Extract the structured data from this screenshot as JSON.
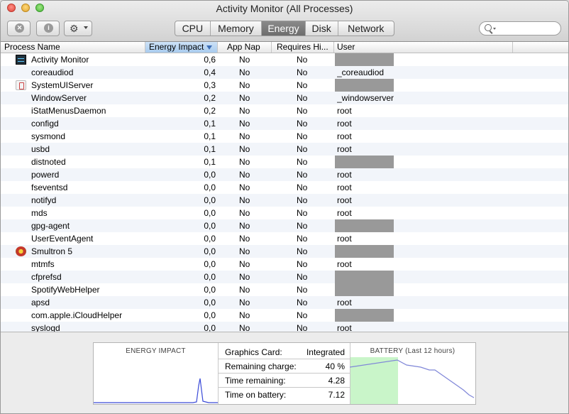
{
  "window": {
    "title": "Activity Monitor (All Processes)"
  },
  "toolbar": {
    "stop_symbol": "✕",
    "info_symbol": "i",
    "gear_symbol": "⚙",
    "tabs": [
      {
        "label": "CPU",
        "active": false
      },
      {
        "label": "Memory",
        "active": false
      },
      {
        "label": "Energy",
        "active": true
      },
      {
        "label": "Disk",
        "active": false
      },
      {
        "label": "Network",
        "active": false
      }
    ],
    "search": {
      "value": "",
      "placeholder": ""
    }
  },
  "table": {
    "columns": {
      "name": "Process Name",
      "energy": "Energy Impact",
      "app_nap": "App Nap",
      "requires_hi": "Requires Hi...",
      "user": "User"
    },
    "rows": [
      {
        "name": "Activity Monitor",
        "energy": "0,6",
        "app_nap": "No",
        "requires_hi": "No",
        "user": "",
        "icon": "activity-monitor-icon"
      },
      {
        "name": "coreaudiod",
        "energy": "0,4",
        "app_nap": "No",
        "requires_hi": "No",
        "user": "_coreaudiod"
      },
      {
        "name": "SystemUIServer",
        "energy": "0,3",
        "app_nap": "No",
        "requires_hi": "No",
        "user": "",
        "icon": "system-ui-server-icon"
      },
      {
        "name": "WindowServer",
        "energy": "0,2",
        "app_nap": "No",
        "requires_hi": "No",
        "user": "_windowserver"
      },
      {
        "name": "iStatMenusDaemon",
        "energy": "0,2",
        "app_nap": "No",
        "requires_hi": "No",
        "user": "root"
      },
      {
        "name": "configd",
        "energy": "0,1",
        "app_nap": "No",
        "requires_hi": "No",
        "user": "root"
      },
      {
        "name": "sysmond",
        "energy": "0,1",
        "app_nap": "No",
        "requires_hi": "No",
        "user": "root"
      },
      {
        "name": "usbd",
        "energy": "0,1",
        "app_nap": "No",
        "requires_hi": "No",
        "user": "root"
      },
      {
        "name": "distnoted",
        "energy": "0,1",
        "app_nap": "No",
        "requires_hi": "No",
        "user": ""
      },
      {
        "name": "powerd",
        "energy": "0,0",
        "app_nap": "No",
        "requires_hi": "No",
        "user": "root"
      },
      {
        "name": "fseventsd",
        "energy": "0,0",
        "app_nap": "No",
        "requires_hi": "No",
        "user": "root"
      },
      {
        "name": "notifyd",
        "energy": "0,0",
        "app_nap": "No",
        "requires_hi": "No",
        "user": "root"
      },
      {
        "name": "mds",
        "energy": "0,0",
        "app_nap": "No",
        "requires_hi": "No",
        "user": "root"
      },
      {
        "name": "gpg-agent",
        "energy": "0,0",
        "app_nap": "No",
        "requires_hi": "No",
        "user": ""
      },
      {
        "name": "UserEventAgent",
        "energy": "0,0",
        "app_nap": "No",
        "requires_hi": "No",
        "user": "root"
      },
      {
        "name": "Smultron 5",
        "energy": "0,0",
        "app_nap": "No",
        "requires_hi": "No",
        "user": "",
        "icon": "smultron-icon"
      },
      {
        "name": "mtmfs",
        "energy": "0,0",
        "app_nap": "No",
        "requires_hi": "No",
        "user": "root"
      },
      {
        "name": "cfprefsd",
        "energy": "0,0",
        "app_nap": "No",
        "requires_hi": "No",
        "user": ""
      },
      {
        "name": "SpotifyWebHelper",
        "energy": "0,0",
        "app_nap": "No",
        "requires_hi": "No",
        "user": ""
      },
      {
        "name": "apsd",
        "energy": "0,0",
        "app_nap": "No",
        "requires_hi": "No",
        "user": "root"
      },
      {
        "name": "com.apple.iCloudHelper",
        "energy": "0,0",
        "app_nap": "No",
        "requires_hi": "No",
        "user": ""
      },
      {
        "name": "syslogd",
        "energy": "0,0",
        "app_nap": "No",
        "requires_hi": "No",
        "user": "root"
      }
    ]
  },
  "summary": {
    "energy_title": "ENERGY IMPACT",
    "battery_title": "BATTERY (Last 12 hours)",
    "stats": [
      {
        "label": "Graphics Card:",
        "value": "Integrated"
      },
      {
        "label": "Remaining charge:",
        "value": "40 %"
      },
      {
        "label": "Time remaining:",
        "value": "4.28"
      },
      {
        "label": "Time on battery:",
        "value": "7.12"
      }
    ]
  },
  "colors": {
    "energy_line": "#3b4bd8",
    "battery_line": "#7f86d8",
    "charging_fill": "#c9f5c9"
  }
}
